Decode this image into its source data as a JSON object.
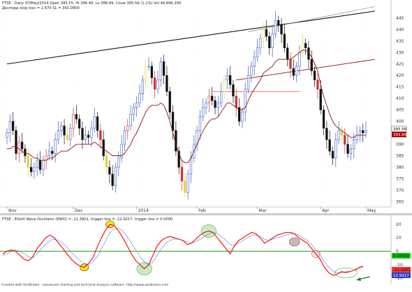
{
  "chart_data": [
    {
      "type": "candlestick",
      "title": "FTSE - Daily 07/May/2014 Open 395.55, Hi 396.49, Lo 388.89, Close 395.56 (1.1%) Vol 44,696,300",
      "subtitle": "Доспорд stop loss = 1.670 SL = 393.0900",
      "x_tick_labels": [
        "Nov",
        "Dec",
        "2014",
        "Feb",
        "Mar",
        "Apr",
        "May"
      ],
      "y_tick_labels": [
        445,
        440,
        435,
        430,
        425,
        420,
        415,
        410,
        405,
        400,
        395,
        390,
        385,
        380,
        375,
        370,
        365
      ],
      "ylim": [
        363,
        448
      ],
      "price_close": 395.56,
      "stop_level": 393.89,
      "series": [
        {
          "name": "Daily close",
          "values": [
            395,
            400,
            396,
            386,
            391,
            388,
            385,
            380,
            378,
            380,
            383,
            379,
            383,
            385,
            387,
            386,
            392,
            396,
            398,
            394,
            392,
            397,
            403,
            401,
            397,
            392,
            394,
            393,
            397,
            402,
            396,
            392,
            385,
            380,
            377,
            372,
            380,
            384,
            390,
            396,
            398,
            403,
            406,
            408,
            412,
            418,
            424,
            424,
            419,
            414,
            418,
            426,
            420,
            413,
            404,
            396,
            387,
            380,
            374,
            369,
            377,
            384,
            390,
            396,
            402,
            406,
            408,
            411,
            409,
            406,
            408,
            413,
            418,
            420,
            416,
            411,
            406,
            400,
            404,
            414,
            420,
            424,
            428,
            432,
            436,
            440,
            437,
            432,
            438,
            444,
            442,
            438,
            432,
            427,
            423,
            420,
            424,
            430,
            434,
            432,
            427,
            422,
            418,
            414,
            405,
            397,
            392,
            387,
            384,
            392,
            396,
            394,
            390,
            386,
            388,
            392,
            394,
            396,
            395,
            396
          ]
        },
        {
          "name": "Trailing stop (dark red)",
          "values": [
            388,
            388,
            389,
            389,
            388,
            387,
            386,
            386,
            385,
            384,
            384,
            383,
            383,
            383,
            384,
            384,
            385,
            386,
            387,
            387,
            387,
            388,
            389,
            390,
            390,
            390,
            390,
            390,
            390,
            391,
            390,
            389,
            388,
            387,
            386,
            385,
            385,
            385,
            385,
            386,
            388,
            390,
            393,
            395,
            398,
            401,
            404,
            406,
            407,
            407,
            407,
            408,
            407,
            404,
            400,
            395,
            390,
            386,
            383,
            382,
            382,
            384,
            387,
            390,
            393,
            396,
            398,
            400,
            401,
            401,
            402,
            404,
            406,
            408,
            408,
            407,
            406,
            405,
            405,
            406,
            409,
            412,
            414,
            416,
            418,
            421,
            422,
            423,
            424,
            426,
            427,
            427,
            427,
            427,
            427,
            428,
            429,
            430,
            431,
            431,
            430,
            428,
            425,
            422,
            416,
            411,
            407,
            403,
            400,
            398,
            397,
            396,
            395,
            394,
            393,
            393,
            394,
            394,
            394,
            394
          ]
        }
      ],
      "annotation_lines": [
        {
          "name": "upper trendline (black)",
          "from": [
            0,
            425
          ],
          "to": [
            122,
            448
          ]
        },
        {
          "name": "secondary trendline (grey)",
          "from": [
            80,
            439
          ],
          "to": [
            122,
            450
          ]
        },
        {
          "name": "resistance (dark red)",
          "from": [
            76,
            418
          ],
          "to": [
            122,
            427
          ]
        },
        {
          "name": "support (red)",
          "from": [
            68,
            413
          ],
          "to": [
            97,
            413
          ]
        }
      ]
    },
    {
      "type": "line",
      "title": "FTSE - Elliott Wave Oscillator (EWO) = -11.3901, trigger line = -12.9217, trigger line = 0.0000",
      "y_tick_labels": [
        20,
        10,
        0,
        -10,
        -20
      ],
      "ylim": [
        -23,
        22
      ],
      "zero_line": 0,
      "ewo_value": -11.3901,
      "trigger_value": -12.9217,
      "zero_badge": "0.00000",
      "value_badges": [
        "-11.3901",
        "12.9217"
      ],
      "series": [
        {
          "name": "EWO",
          "values": [
            -2,
            0,
            1,
            0,
            -3,
            -6,
            -7,
            -4,
            2,
            6,
            10,
            12,
            10,
            6,
            2,
            -2,
            -6,
            -9,
            -11,
            -12,
            -9,
            -5,
            3,
            10,
            16,
            20,
            19,
            15,
            10,
            4,
            -2,
            -7,
            -10,
            -13,
            -10,
            -3,
            4,
            8,
            10,
            11,
            10,
            9,
            8,
            5,
            6,
            9,
            12,
            14,
            15,
            14,
            10,
            6,
            2,
            -2,
            4,
            8,
            10,
            12,
            14,
            13,
            10,
            6,
            8,
            10,
            12,
            13,
            14,
            14,
            13,
            10,
            8,
            6,
            2,
            -2,
            -6,
            -12,
            -16,
            -18,
            -17,
            -15,
            -16,
            -15,
            -14,
            -12,
            -11
          ]
        },
        {
          "name": "Trigger",
          "values": [
            -3,
            -2,
            0,
            1,
            0,
            -2,
            -4,
            -5,
            -2,
            2,
            5,
            8,
            9,
            8,
            6,
            3,
            -1,
            -4,
            -7,
            -9,
            -10,
            -8,
            -4,
            2,
            8,
            14,
            17,
            17,
            15,
            11,
            6,
            1,
            -4,
            -8,
            -10,
            -8,
            -3,
            2,
            6,
            8,
            9,
            9,
            8,
            7,
            6,
            7,
            9,
            11,
            13,
            14,
            13,
            11,
            8,
            5,
            4,
            6,
            8,
            10,
            12,
            12,
            11,
            9,
            8,
            9,
            10,
            11,
            12,
            13,
            13,
            12,
            10,
            8,
            5,
            1,
            -3,
            -8,
            -12,
            -15,
            -16,
            -16,
            -15,
            -15,
            -14,
            -13,
            -12
          ]
        }
      ]
    }
  ],
  "footer": {
    "credit": "Created with AmiBroker - advanced charting and technical analysis software. http://www.amibroker.com"
  },
  "colors": {
    "up_candle": "#3a5cc8",
    "down_candle": "#111111",
    "stop_line": "#8c1010",
    "ewo_line": "#ff0000",
    "trigger_line": "#3b5bd6",
    "zero_line": "#009900",
    "price_badge_bg": "#ffffff",
    "stop_badge_bg": "#b00000",
    "ewo_badge_bg": "#ff3333",
    "trigger_badge_bg": "#2a3fd0",
    "zero_badge_bg": "#00cc00"
  }
}
